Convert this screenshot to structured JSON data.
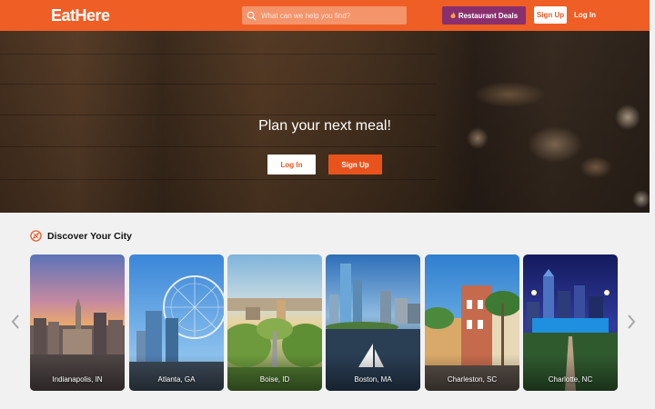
{
  "header": {
    "logo": "EatHere",
    "search_placeholder": "What can we help you find?",
    "deals_label": "Restaurant Deals",
    "signup_label": "Sign Up",
    "login_label": "Log In",
    "brand_color": "#ee5e25",
    "deals_color": "#8a2f6e"
  },
  "hero": {
    "title": "Plan your next meal!",
    "login_label": "Log In",
    "signup_label": "Sign Up"
  },
  "discover": {
    "title": "Discover Your City",
    "cities": [
      {
        "name": "Indianapolis, IN"
      },
      {
        "name": "Atlanta, GA"
      },
      {
        "name": "Boise, ID"
      },
      {
        "name": "Boston, MA"
      },
      {
        "name": "Charleston, SC"
      },
      {
        "name": "Charlotte, NC"
      }
    ]
  }
}
